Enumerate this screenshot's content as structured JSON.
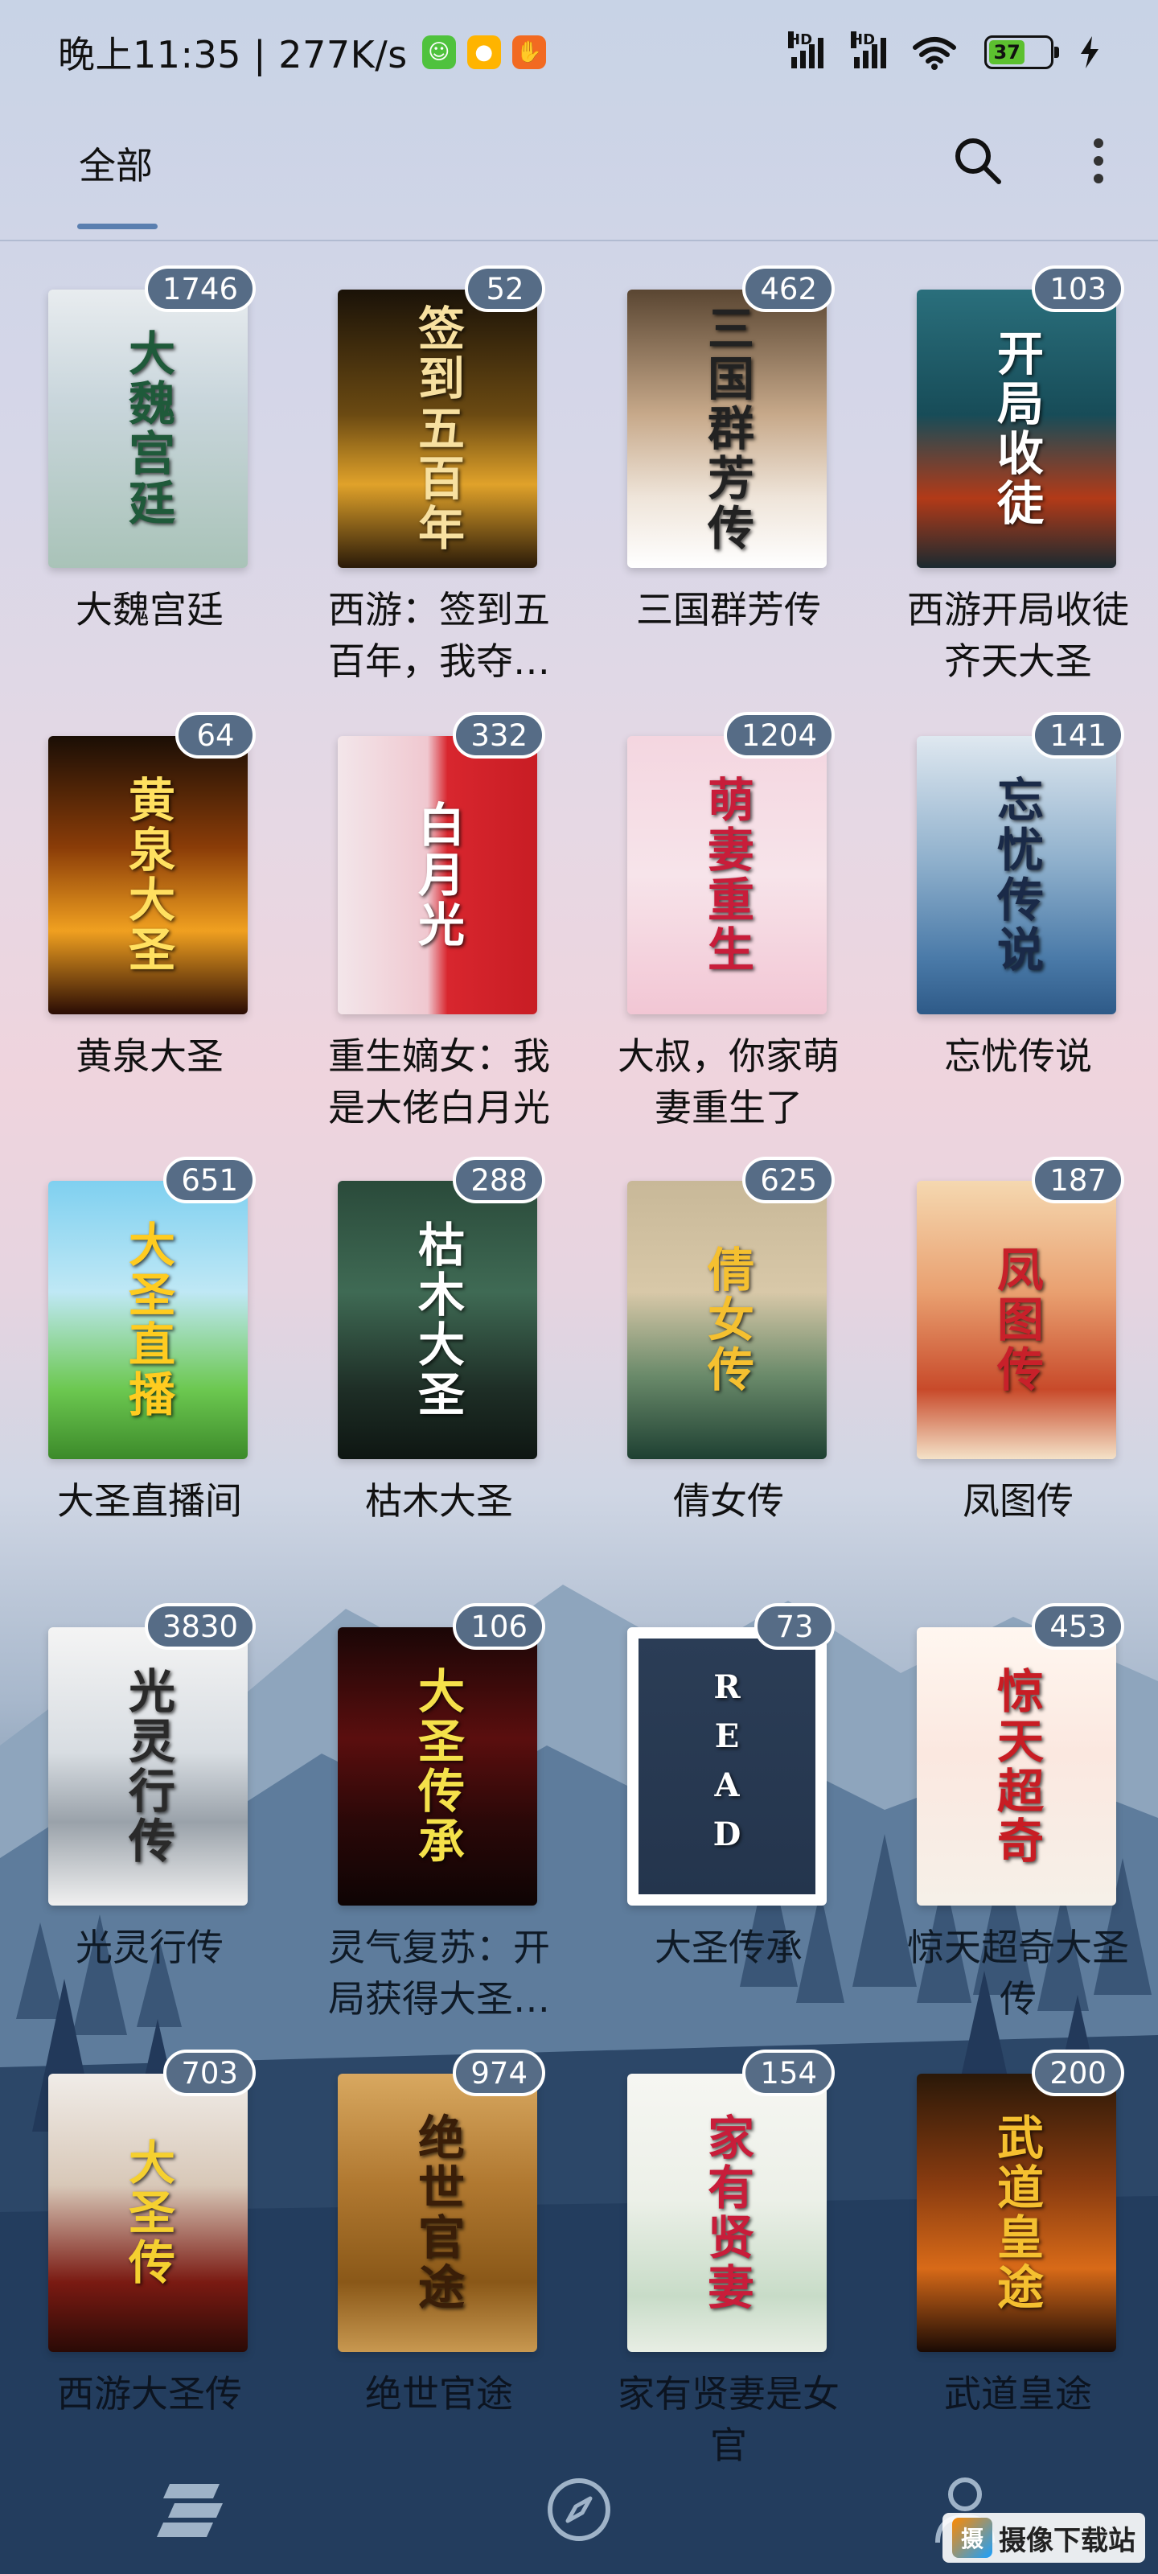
{
  "status_bar": {
    "time": "晚上11:35 | 277K/s",
    "apps": [
      {
        "icon": "wechat-mini-icon",
        "color": "#4fc23d",
        "glyph": "☺"
      },
      {
        "icon": "fish-app-icon",
        "color": "#ffb400",
        "glyph": "●"
      },
      {
        "icon": "hand-app-icon",
        "color": "#f26a21",
        "glyph": "✋"
      }
    ],
    "battery": "37",
    "hd1": "HD",
    "hd2": "HD"
  },
  "top_bar": {
    "tab_label": "全部"
  },
  "books": [
    {
      "title": "大魏宫廷",
      "count": "1746",
      "cover_text": "大魏宫廷",
      "bg": "linear-gradient(180deg,#e8ecef 0%,#c9d6dc 40%,#a9c3b8 100%)",
      "text_color": "#1f5a3a"
    },
    {
      "title": "西游：签到五百年，我夺…",
      "count": "52",
      "cover_text": "签到五百年",
      "bg": "linear-gradient(180deg,#1a1208 0%,#6b4a12 45%,#e0a22a 70%,#2a1a08 100%)",
      "text_color": "#f7e0a0"
    },
    {
      "title": "三国群芳传",
      "count": "462",
      "cover_text": "三国群芳传",
      "bg": "linear-gradient(180deg,#5a4632 0%,#c7a98a 45%,#efe5da 75%,#ffffff 100%)",
      "text_color": "#222"
    },
    {
      "title": "西游开局收徒齐天大圣",
      "count": "103",
      "cover_text": "开局收徒",
      "bg": "linear-gradient(180deg,#2a6f7c 0%,#174c58 45%,#b23a18 75%,#1b2a30 100%)",
      "text_color": "#ffffff"
    },
    {
      "title": "黄泉大圣",
      "count": "64",
      "cover_text": "黄泉大圣",
      "bg": "linear-gradient(180deg,#1a0e05 0%,#8a3c08 40%,#f0a020 70%,#2a0c04 100%)",
      "text_color": "#ffe060"
    },
    {
      "title": "重生嫡女：我是大佬白月光",
      "count": "332",
      "cover_text": "白月光",
      "bg": "linear-gradient(90deg,#f3e6ea 0%,#f0c8d0 45%,#d8262e 55%,#c81d24 100%)",
      "text_color": "#ffffff"
    },
    {
      "title": "大叔，你家萌妻重生了",
      "count": "1204",
      "cover_text": "萌妻重生",
      "bg": "linear-gradient(180deg,#f4d6e0 0%,#f7e4ea 50%,#f2c6d4 100%)",
      "text_color": "#c81d3a"
    },
    {
      "title": "忘忧传说",
      "count": "141",
      "cover_text": "忘忧传说",
      "bg": "linear-gradient(180deg,#dfe8f0 0%,#8fb0cc 45%,#4a7aa8 80%,#2e5a88 100%)",
      "text_color": "#1a2a48"
    },
    {
      "title": "大圣直播间",
      "count": "651",
      "cover_text": "大圣直播",
      "bg": "linear-gradient(180deg,#7fd0f0 0%,#bfe8f5 40%,#6cc850 75%,#3c8a2a 100%)",
      "text_color": "#ffcc20"
    },
    {
      "title": "枯木大圣",
      "count": "288",
      "cover_text": "枯木大圣",
      "bg": "linear-gradient(180deg,#2a4a3a 0%,#3f6a54 40%,#1e2e26 75%,#0e1612 100%)",
      "text_color": "#ffffff"
    },
    {
      "title": "倩女传",
      "count": "625",
      "cover_text": "倩女传",
      "bg": "linear-gradient(180deg,#c8b898 0%,#d8c8a8 40%,#6a8a6a 70%,#1e4032 100%)",
      "text_color": "#f5c030"
    },
    {
      "title": "凤图传",
      "count": "187",
      "cover_text": "凤图传",
      "bg": "linear-gradient(180deg,#f5d8b0 0%,#e9a070 40%,#c84a2a 75%,#f4e2c8 100%)",
      "text_color": "#c8202a"
    },
    {
      "title": "光灵行传",
      "count": "3830",
      "cover_text": "光灵行传",
      "bg": "linear-gradient(180deg,#f4f4f4 0%,#d8dde2 45%,#9aa2aa 70%,#f0f0f0 100%)",
      "text_color": "#2a2a2a"
    },
    {
      "title": "灵气复苏：开局获得大圣…",
      "count": "106",
      "cover_text": "大圣传承",
      "bg": "linear-gradient(180deg,#1a0606 0%,#5a0e0e 40%,#2a0808 70%,#0e0404 100%)",
      "text_color": "#f5e14a"
    },
    {
      "title": "大圣传承",
      "count": "73",
      "cover_text": "READ",
      "bg": "linear-gradient(180deg,#2b3d56 0%,#24354d 100%)",
      "text_color": "#ffffff"
    },
    {
      "title": "惊天超奇大圣传",
      "count": "453",
      "cover_text": "惊天超奇",
      "bg": "linear-gradient(180deg,#fff7f0 0%,#fbe8e0 45%,#f6f0e8 100%)",
      "text_color": "#c81d24"
    },
    {
      "title": "西游大圣传",
      "count": "703",
      "cover_text": "大圣传",
      "bg": "linear-gradient(180deg,#f0ece8 0%,#d8c8b8 40%,#7a1a12 75%,#2a0a06 100%)",
      "text_color": "#f5d030"
    },
    {
      "title": "绝世官途",
      "count": "974",
      "cover_text": "绝世官途",
      "bg": "linear-gradient(180deg,#d8a860 0%,#b07830 40%,#8a5818 75%,#c89850 100%)",
      "text_color": "#3a1e08"
    },
    {
      "title": "家有贤妻是女官",
      "count": "154",
      "cover_text": "家有贤妻",
      "bg": "linear-gradient(180deg,#f6f6f2 0%,#ecf0e8 45%,#c8dcc8 80%,#e8eee4 100%)",
      "text_color": "#c81d3a"
    },
    {
      "title": "武道皇途",
      "count": "200",
      "cover_text": "武道皇途",
      "bg": "linear-gradient(180deg,#2a1808 0%,#8a3c10 40%,#d86a18 70%,#1a0a04 100%)",
      "text_color": "#f5c030"
    }
  ],
  "bottom_nav": {
    "items": [
      "bookshelf-icon",
      "explore-compass-icon",
      "profile-icon"
    ]
  },
  "watermark": {
    "logo": "摄",
    "text": "摄像下载站"
  }
}
